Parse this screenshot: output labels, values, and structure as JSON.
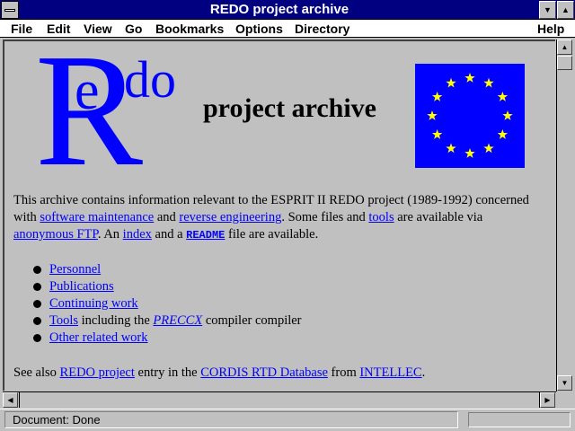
{
  "window": {
    "title": "REDO project archive"
  },
  "menu": [
    "File",
    "Edit",
    "View",
    "Go",
    "Bookmarks",
    "Options",
    "Directory",
    "Help"
  ],
  "logo": {
    "r": "R",
    "e": "e",
    "do": "do",
    "subtitle": "project archive"
  },
  "intro": {
    "t1": "This archive contains information relevant to the ESPRIT II REDO project (1989-1992) concerned with ",
    "link1": "software maintenance",
    "t2": " and ",
    "link2": "reverse engineering",
    "t3": ". Some files and ",
    "link3": "tools",
    "t4": " are available via ",
    "link4": "anonymous FTP",
    "t5": ". An ",
    "link5": "index",
    "t6": " and a ",
    "link6": "README",
    "t7": " file are available."
  },
  "list": {
    "personnel": "Personnel",
    "publications": "Publications",
    "continuing": "Continuing work",
    "tools_link": "Tools",
    "tools_text": " including the ",
    "preccx": "PRECCX",
    "tools_text2": " compiler compiler",
    "other": "Other related work"
  },
  "see_also": {
    "t1": "See also ",
    "link1": "REDO project",
    "t2": " entry in the ",
    "link2": "CORDIS RTD Database",
    "t3": " from ",
    "link3": "INTELLEC",
    "t4": "."
  },
  "status": {
    "text": "Document: Done"
  },
  "colors": {
    "title_bar": "#000080",
    "link": "#0000ff",
    "logo": "#0000ff",
    "flag_bg": "#0000ff",
    "flag_star": "#ffff00",
    "bg": "#c0c0c0"
  },
  "icons": {
    "minimize": "triangle-down",
    "maximize": "triangle-up",
    "scroll_up": "triangle-up",
    "scroll_down": "triangle-down",
    "scroll_left": "triangle-left",
    "scroll_right": "triangle-right"
  }
}
